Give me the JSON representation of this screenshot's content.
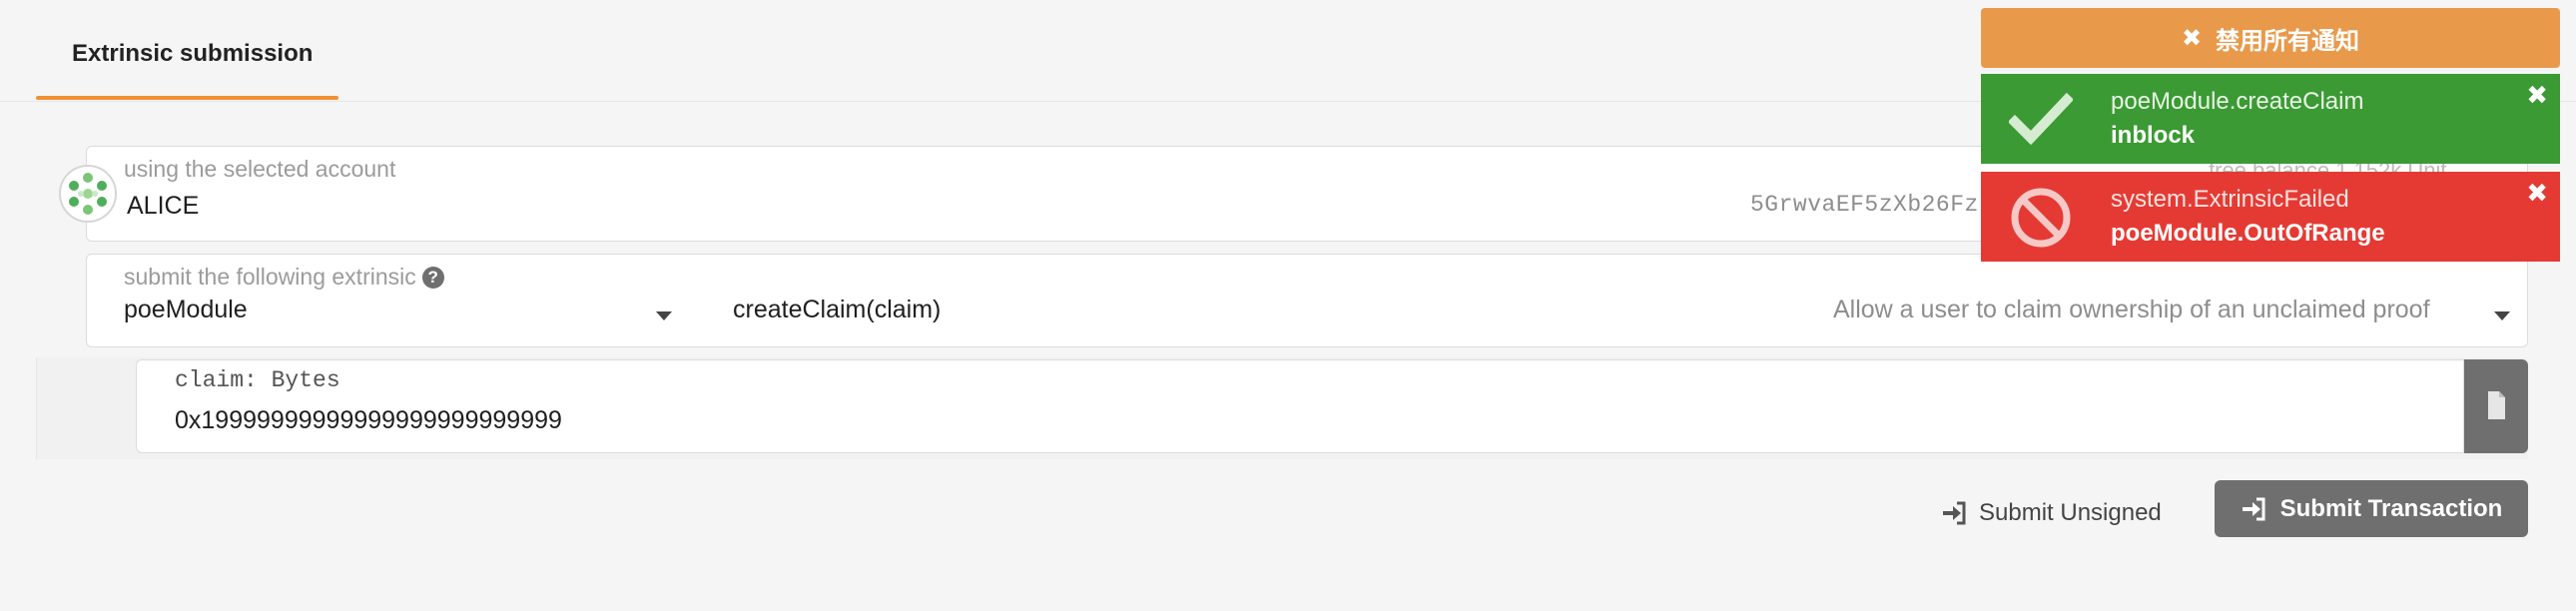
{
  "tabs": {
    "active_label": "Extrinsic submission"
  },
  "account": {
    "label": "using the selected account",
    "name": "ALICE",
    "address_truncated": "5GrwvaEF5zXb26Fz",
    "balance_hint": "free balance 1.152k Unit",
    "avatar_icon": "identicon-icon"
  },
  "extrinsic": {
    "label": "submit the following extrinsic",
    "help_glyph": "?",
    "module": "poeModule",
    "method": "createClaim(claim)",
    "description": "Allow a user to claim ownership of an unclaimed proof"
  },
  "params": [
    {
      "label": "claim: Bytes",
      "value": "0x19999999999999999999999999"
    }
  ],
  "actions": {
    "unsigned_label": "Submit Unsigned",
    "submit_label": "Submit Transaction"
  },
  "notifications": {
    "dismiss_label": "禁用所有通知",
    "items": [
      {
        "title": "poeModule.createClaim",
        "status": "inblock",
        "type": "success",
        "color": "#3b9a33",
        "icon": "check-icon"
      },
      {
        "title": "system.ExtrinsicFailed",
        "status": "poeModule.OutOfRange",
        "type": "error",
        "color": "#e53a33",
        "icon": "ban-icon"
      }
    ]
  },
  "colors": {
    "accent": "#f19135",
    "dismiss_bg": "#e9994a",
    "button_dark": "#6f6f6f"
  }
}
